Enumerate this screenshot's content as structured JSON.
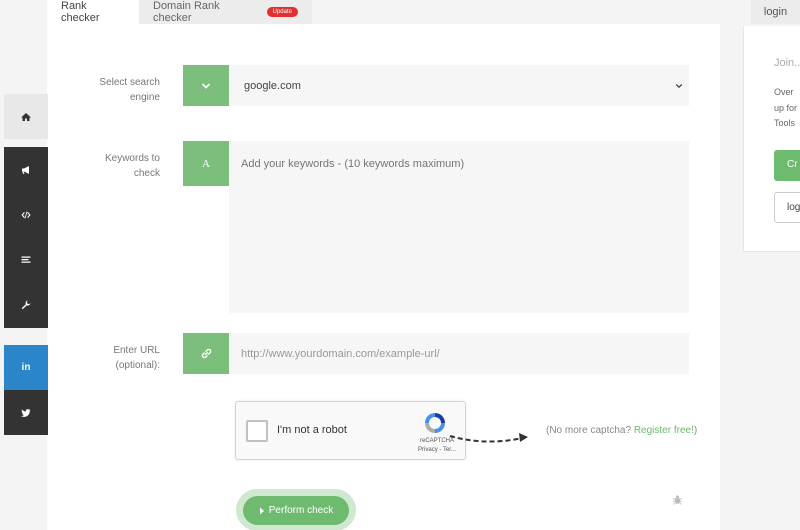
{
  "tabs": {
    "rank_checker": "Rank checker",
    "domain_rank_checker": "Domain Rank checker",
    "update_badge": "Update",
    "login": "login"
  },
  "sidebar": {
    "items": [
      {
        "name": "home",
        "icon": "home-icon",
        "color": "#e8e8e8"
      },
      {
        "name": "announcements",
        "icon": "megaphone-icon",
        "color": "#333333"
      },
      {
        "name": "code",
        "icon": "code-icon",
        "color": "#333333"
      },
      {
        "name": "list",
        "icon": "list-icon",
        "color": "#333333"
      },
      {
        "name": "tools",
        "icon": "wrench-icon",
        "color": "#333333"
      },
      {
        "name": "linkedin",
        "icon": "linkedin-icon",
        "color": "#2a86c8"
      },
      {
        "name": "twitter",
        "icon": "twitter-icon",
        "color": "#333333"
      }
    ],
    "linkedin_label": "in"
  },
  "form": {
    "search_engine_label": "Select search engine",
    "search_engine_value": "google.com",
    "keywords_label": "Keywords to check",
    "keywords_icon_letter": "A",
    "keywords_placeholder": "Add your keywords - (10 keywords maximum)",
    "url_label": "Enter URL (optional):",
    "url_placeholder": "http://www.yourdomain.com/example-url/"
  },
  "captcha": {
    "label": "I'm not a robot",
    "brand": "reCAPTCHA",
    "links": "Privacy - Ter..."
  },
  "no_captcha": {
    "text": "(No more captcha? ",
    "link": "Register free!",
    "close": ")"
  },
  "submit_label": "Perform check",
  "right_panel": {
    "title": "Join..",
    "line1": "Over",
    "line2": "up for",
    "line3": "Tools",
    "cta": "Cr",
    "login": "log"
  },
  "colors": {
    "accent_green": "#7cbf7d",
    "button_green": "#6ebb70",
    "linkedin_blue": "#2a86c8",
    "sidebar_dark": "#333333",
    "badge_red": "#e03030"
  }
}
